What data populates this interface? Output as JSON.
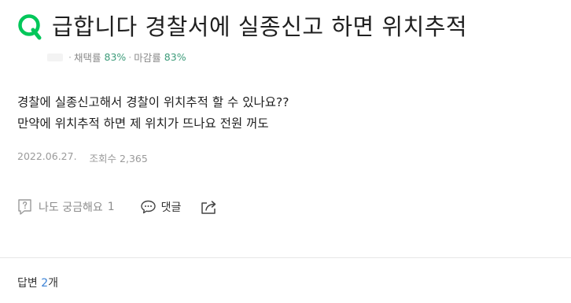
{
  "question": {
    "icon": "q-icon",
    "title": "급합니다 경찰서에 실종신고 하면 위치추적"
  },
  "author_meta": {
    "adoption_label": "채택률",
    "adoption_rate": "83%",
    "deadline_label": "마감률",
    "deadline_rate": "83%",
    "separator": "·"
  },
  "body": {
    "line1": "경찰에 실종신고해서 경찰이 위치추적 할 수 있나요??",
    "line2": "만약에 위치추적 하면 제 위치가 뜨나요 전원 꺼도"
  },
  "info": {
    "date": "2022.06.27.",
    "views": "조회수 2,365"
  },
  "actions": {
    "curious_label": "나도 궁금해요",
    "curious_count": "1",
    "comment_label": "댓글",
    "icons": [
      "question-doc-icon",
      "speech-bubble-icon",
      "share-icon"
    ]
  },
  "answers": {
    "label": "답변",
    "count": "2",
    "suffix": "개"
  },
  "colors": {
    "brand_green": "#03c75a",
    "rate_green": "#3d9c7a",
    "count_blue": "#3b82d6"
  }
}
